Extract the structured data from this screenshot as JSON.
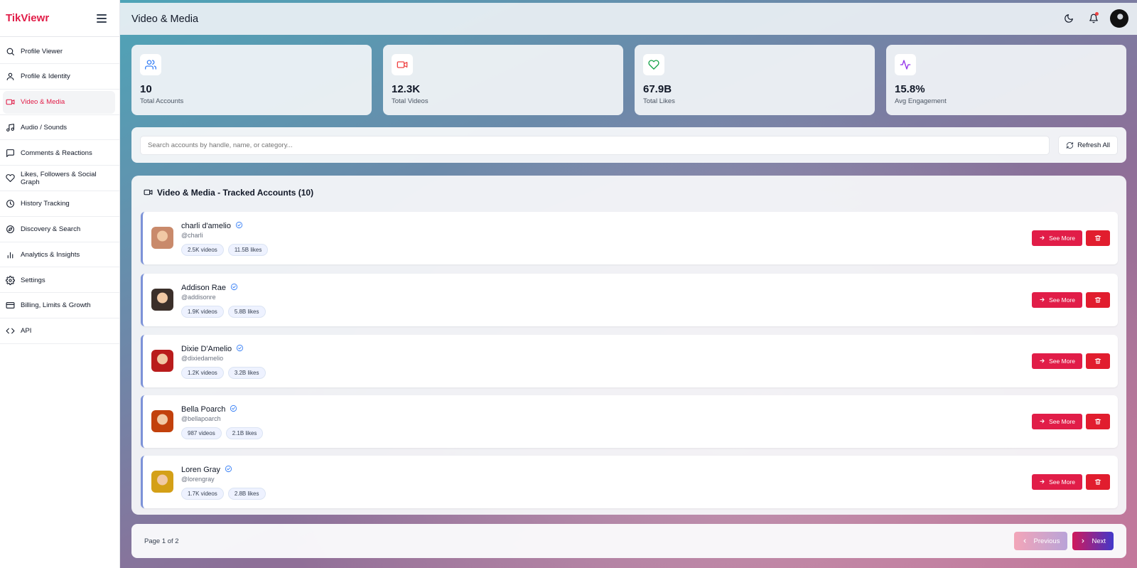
{
  "brand": {
    "name": "TikViewr"
  },
  "sidebar": {
    "items": [
      {
        "label": "Profile Viewer",
        "icon": "search-icon",
        "active": false
      },
      {
        "label": "Profile & Identity",
        "icon": "user-icon",
        "active": false
      },
      {
        "label": "Video & Media",
        "icon": "video-icon",
        "active": true
      },
      {
        "label": "Audio / Sounds",
        "icon": "music-icon",
        "active": false
      },
      {
        "label": "Comments & Reactions",
        "icon": "comment-icon",
        "active": false
      },
      {
        "label": "Likes, Followers & Social Graph",
        "icon": "heart-icon",
        "active": false
      },
      {
        "label": "History Tracking",
        "icon": "clock-icon",
        "active": false
      },
      {
        "label": "Discovery & Search",
        "icon": "compass-icon",
        "active": false
      },
      {
        "label": "Analytics & Insights",
        "icon": "bar-chart-icon",
        "active": false
      },
      {
        "label": "Settings",
        "icon": "gear-icon",
        "active": false
      },
      {
        "label": "Billing, Limits & Growth",
        "icon": "credit-card-icon",
        "active": false
      },
      {
        "label": "API",
        "icon": "code-icon",
        "active": false
      }
    ]
  },
  "header": {
    "title": "Video & Media"
  },
  "stats": [
    {
      "value": "10",
      "label": "Total Accounts",
      "icon": "users-icon",
      "color": "#3b82f6"
    },
    {
      "value": "12.3K",
      "label": "Total Videos",
      "icon": "video-icon",
      "color": "#ef4444"
    },
    {
      "value": "67.9B",
      "label": "Total Likes",
      "icon": "heart-icon",
      "color": "#16a34a"
    },
    {
      "value": "15.8%",
      "label": "Avg Engagement",
      "icon": "activity-icon",
      "color": "#9333ea"
    }
  ],
  "search": {
    "placeholder": "Search accounts by handle, name, or category...",
    "refresh_label": "Refresh All"
  },
  "list": {
    "title": "Video & Media - Tracked Accounts (10)",
    "see_more_label": "See More",
    "accounts": [
      {
        "name": "charli d'amelio",
        "handle": "@charli",
        "videos": "2.5K videos",
        "likes": "11.5B likes",
        "avatar_color": "#c98a6b"
      },
      {
        "name": "Addison Rae",
        "handle": "@addisonre",
        "videos": "1.9K videos",
        "likes": "5.8B likes",
        "avatar_color": "#3b2f2a"
      },
      {
        "name": "Dixie D'Amelio",
        "handle": "@dixiedamelio",
        "videos": "1.2K videos",
        "likes": "3.2B likes",
        "avatar_color": "#b91c1c"
      },
      {
        "name": "Bella Poarch",
        "handle": "@bellapoarch",
        "videos": "987 videos",
        "likes": "2.1B likes",
        "avatar_color": "#c2410c"
      },
      {
        "name": "Loren Gray",
        "handle": "@lorengray",
        "videos": "1.7K videos",
        "likes": "2.8B likes",
        "avatar_color": "#d4a017"
      }
    ]
  },
  "pagination": {
    "text": "Page 1 of 2",
    "previous_label": "Previous",
    "next_label": "Next"
  }
}
